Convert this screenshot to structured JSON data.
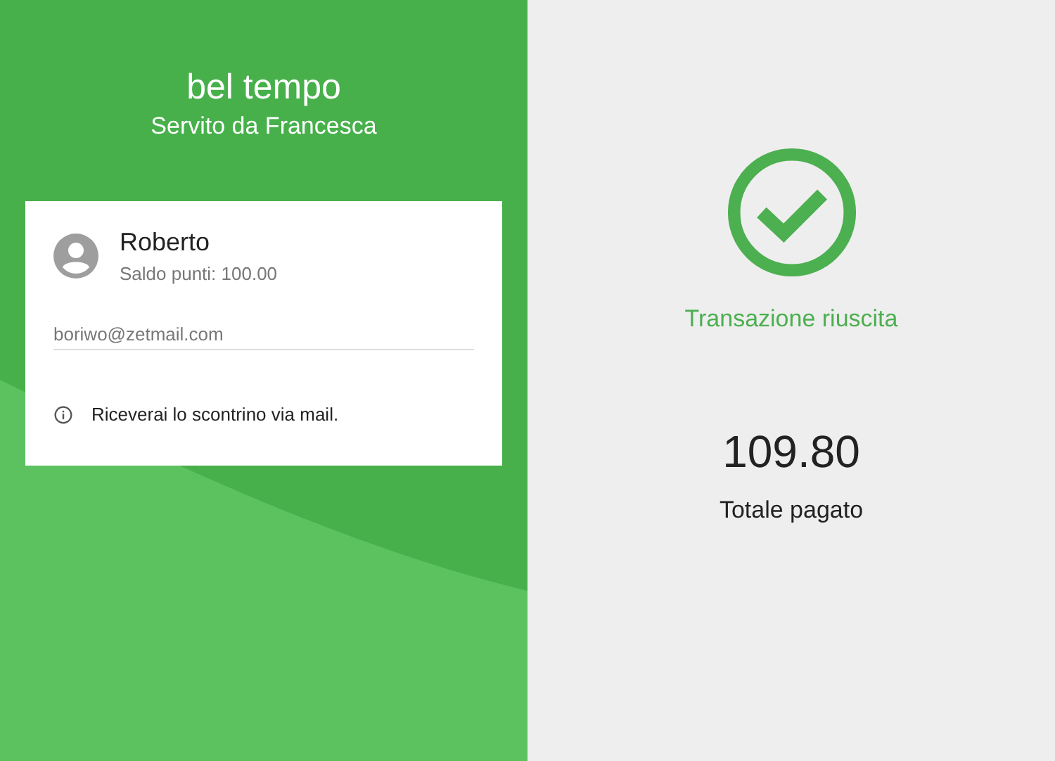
{
  "store": {
    "name": "bel tempo",
    "served_by": "Servito da Francesca"
  },
  "customer": {
    "name": "Roberto",
    "points": "Saldo punti: 100.00",
    "email": "boriwo@zetmail.com",
    "notice": "Riceverai lo scontrino via mail."
  },
  "result": {
    "status": "Transazione riuscita",
    "amount": "109.80",
    "amount_label": "Totale pagato"
  }
}
